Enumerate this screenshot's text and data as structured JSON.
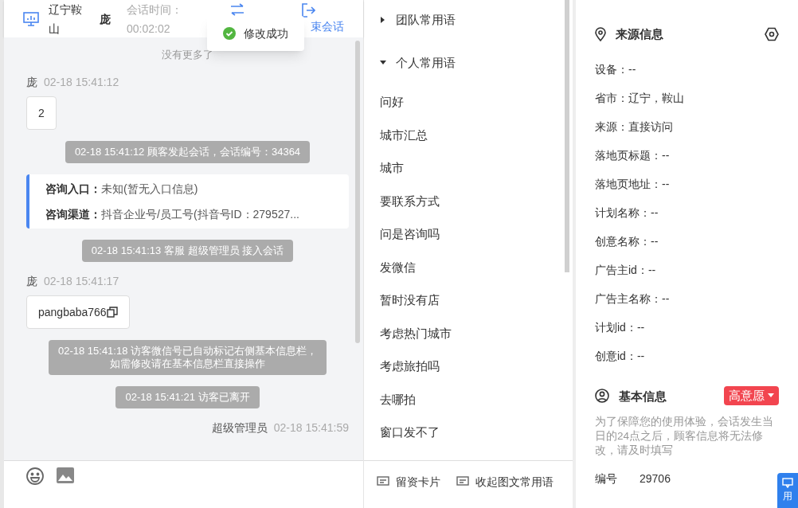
{
  "header": {
    "location": "辽宁鞍山",
    "visitor": "庞",
    "session_label": "会话时间：",
    "session_time": "00:02:02",
    "end_label": "束会话"
  },
  "toast": {
    "text": "修改成功"
  },
  "chat": {
    "top_note": "没有更多了",
    "messages": [
      {
        "kind": "visitor",
        "sender": "庞",
        "time": "02-18 15:41:12",
        "text": "2",
        "copy": false
      },
      {
        "kind": "system",
        "text": "02-18 15:41:12 顾客发起会话，会话编号：34364"
      },
      {
        "kind": "info",
        "rows": [
          {
            "label": "咨询入口：",
            "value": "未知(暂无入口信息)"
          },
          {
            "label": "咨询渠道：",
            "value": "抖音企业号/员工号(抖音号ID：279527..."
          }
        ]
      },
      {
        "kind": "system",
        "text": "02-18 15:41:13 客服 超级管理员 接入会话"
      },
      {
        "kind": "visitor",
        "sender": "庞",
        "time": "02-18 15:41:17",
        "text": "pangbaba766",
        "copy": true
      },
      {
        "kind": "system",
        "lines": [
          "02-18 15:41:18 访客微信号已自动标记右侧基本信息栏，",
          "如需修改请在基本信息栏直接操作"
        ]
      },
      {
        "kind": "system",
        "text": "02-18 15:41:21 访客已离开"
      },
      {
        "kind": "agent",
        "sender": "超级管理员",
        "time": "02-18 15:41:59"
      }
    ]
  },
  "toolbar": {
    "buttons": [
      "留资卡片",
      "收起图文常用语"
    ]
  },
  "phrases": [
    {
      "title": "团队常用语",
      "expanded": false
    },
    {
      "title": "个人常用语",
      "expanded": true,
      "items": [
        "问好",
        "城市汇总",
        "城市",
        "要联系方式",
        "问是咨询吗",
        "发微信",
        "暂时没有店",
        "考虑热门城市",
        "考虑旅拍吗",
        "去哪拍",
        "窗口发不了"
      ]
    }
  ],
  "source": {
    "title": "来源信息",
    "rows": [
      "设备：--",
      "省市：辽宁，鞍山",
      "来源：直接访问",
      "落地页标题：--",
      "落地页地址：--",
      "计划名称：--",
      "创意名称：--",
      "广告主id：--",
      "广告主名称：--",
      "计划id：--",
      "创意id：--"
    ]
  },
  "basic": {
    "title": "基本信息",
    "tag": "高意愿",
    "notice": "为了保障您的使用体验，会话发生当日的24点之后，顾客信息将无法修改，请及时填写",
    "fields": [
      {
        "label": "编号",
        "value": "29706"
      }
    ]
  },
  "float_button": {
    "text": "用"
  }
}
